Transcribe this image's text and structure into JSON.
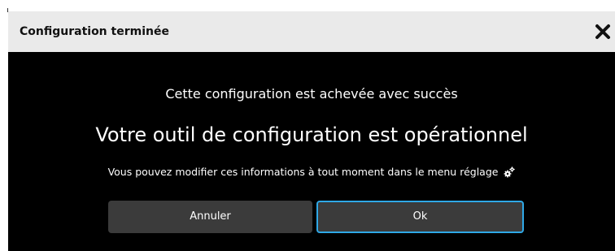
{
  "dialog": {
    "title": "Configuration terminée",
    "close_icon": "close-icon",
    "subtitle": "Cette configuration est achevée avec succès",
    "headline": "Votre outil de configuration est opérationnel",
    "info": "Vous pouvez modifier ces informations à tout moment dans le menu réglage",
    "info_icon": "gears-icon",
    "buttons": {
      "cancel_label": "Annuler",
      "ok_label": "Ok"
    }
  },
  "colors": {
    "titlebar_bg": "#eaeaea",
    "dialog_bg": "#000000",
    "button_bg": "#3b3b3b",
    "focus_border": "#2fa8e6"
  }
}
